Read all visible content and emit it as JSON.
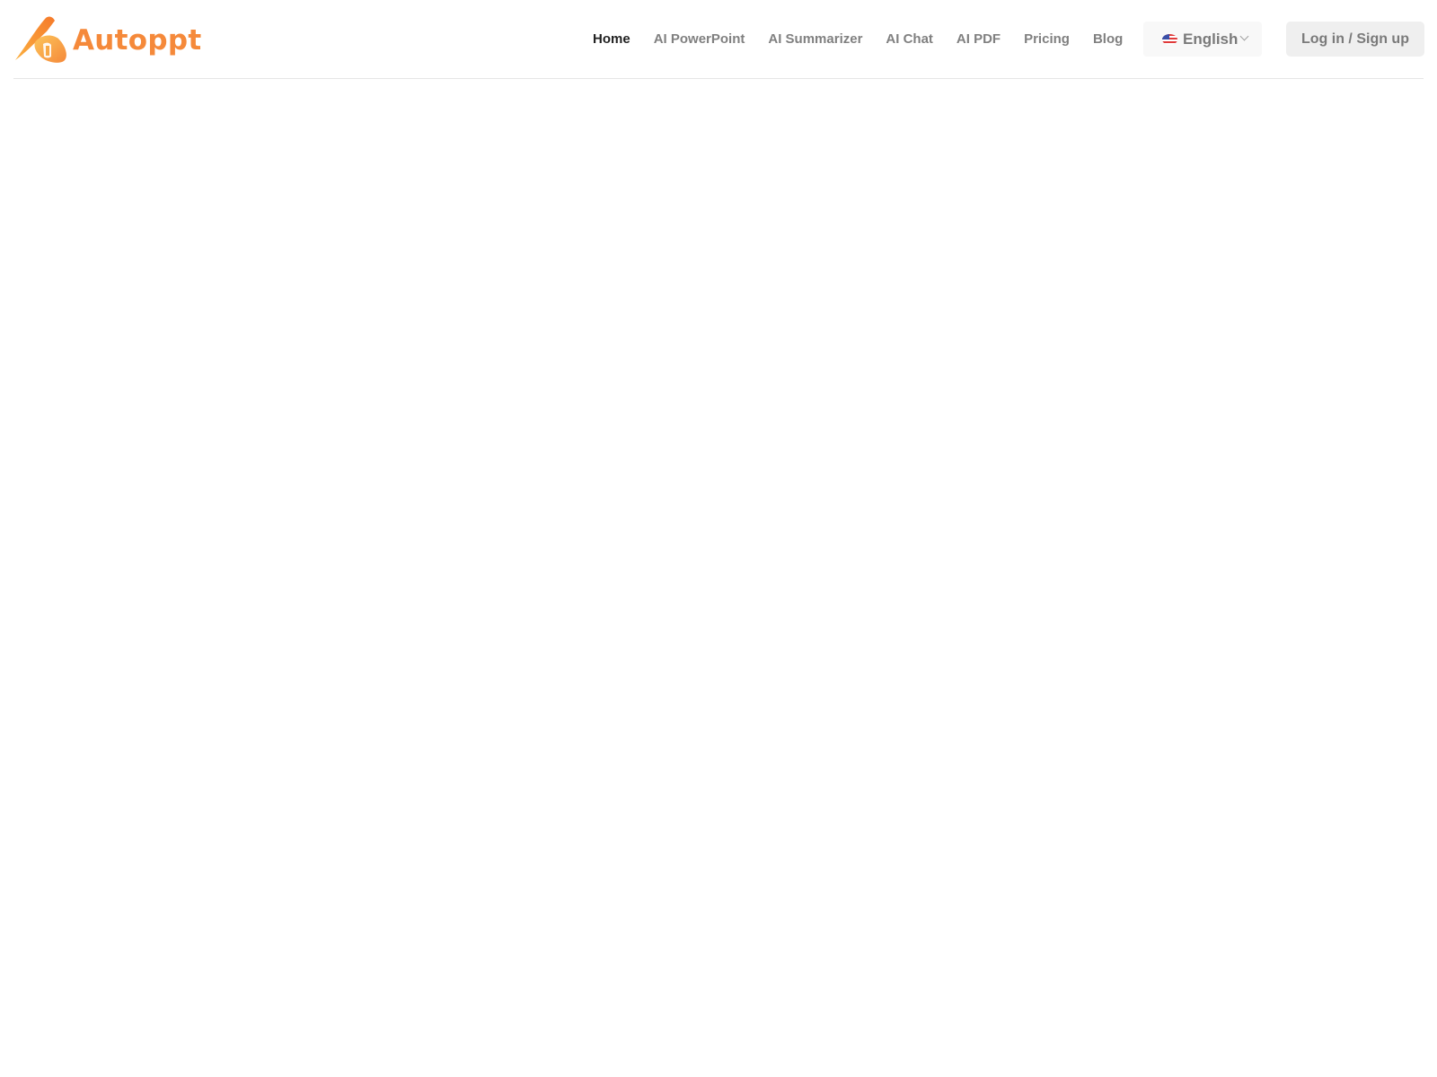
{
  "brand": {
    "name": "Autoppt",
    "color": "#f5893a"
  },
  "nav": {
    "items": [
      {
        "label": "Home",
        "active": true
      },
      {
        "label": "AI PowerPoint",
        "active": false
      },
      {
        "label": "AI Summarizer",
        "active": false
      },
      {
        "label": "AI Chat",
        "active": false
      },
      {
        "label": "AI PDF",
        "active": false
      },
      {
        "label": "Pricing",
        "active": false
      },
      {
        "label": "Blog",
        "active": false
      }
    ]
  },
  "language": {
    "flag_icon": "us-flag-icon",
    "selected": "English"
  },
  "auth": {
    "login_label": "Log in / Sign up"
  }
}
